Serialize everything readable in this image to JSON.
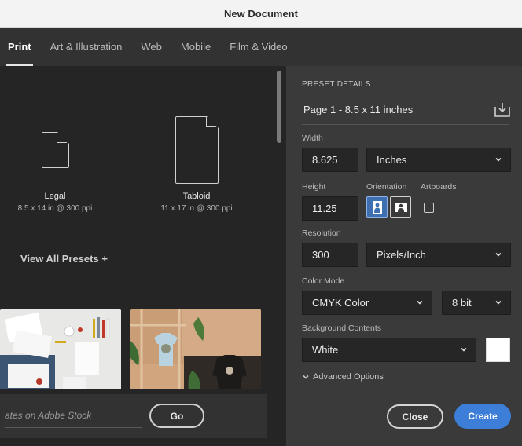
{
  "window": {
    "title": "New Document"
  },
  "tabs": [
    {
      "label": "Print",
      "active": true
    },
    {
      "label": "Art & Illustration",
      "active": false
    },
    {
      "label": "Web",
      "active": false
    },
    {
      "label": "Mobile",
      "active": false
    },
    {
      "label": "Film & Video",
      "active": false
    }
  ],
  "presets": [
    {
      "name": "Legal",
      "size": "8.5 x 14 in @ 300 ppi"
    },
    {
      "name": "Tabloid",
      "size": "11 x 17 in @ 300 ppi"
    }
  ],
  "view_all": "View All Presets +",
  "stock": {
    "search_placeholder": "ates on Adobe Stock",
    "go_label": "Go"
  },
  "details": {
    "section_title": "PRESET DETAILS",
    "preset_name": "Page 1 - 8.5 x 11 inches",
    "width_label": "Width",
    "width_value": "8.625",
    "units": "Inches",
    "height_label": "Height",
    "height_value": "11.25",
    "orientation_label": "Orientation",
    "artboards_label": "Artboards",
    "resolution_label": "Resolution",
    "resolution_value": "300",
    "resolution_units": "Pixels/Inch",
    "color_mode_label": "Color Mode",
    "color_mode": "CMYK Color",
    "bit_depth": "8 bit",
    "background_label": "Background Contents",
    "background": "White",
    "advanced": "Advanced Options"
  },
  "actions": {
    "close": "Close",
    "create": "Create"
  },
  "colors": {
    "accent": "#3d7ed8",
    "panel": "#3a3a3a",
    "left_panel": "#252525"
  }
}
